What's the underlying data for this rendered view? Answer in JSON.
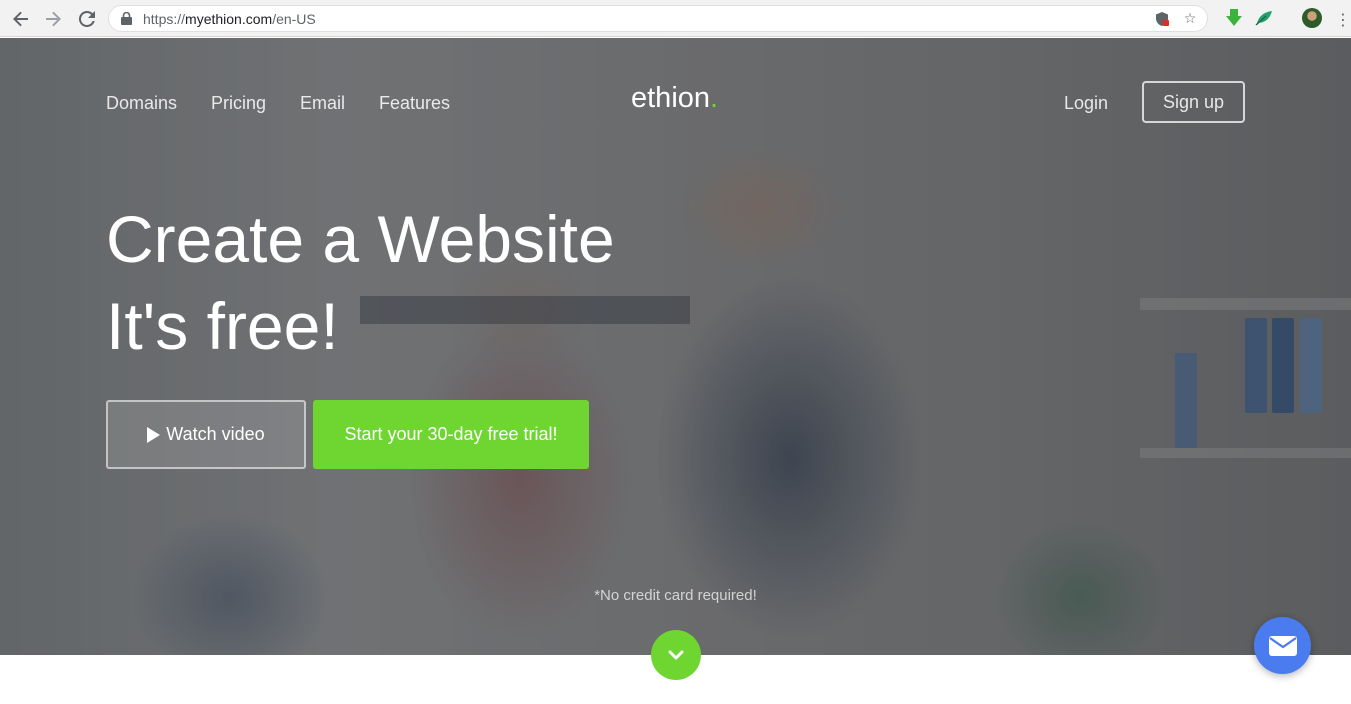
{
  "browser": {
    "back_icon": "back-arrow-icon",
    "forward_icon": "forward-arrow-icon",
    "reload_icon": "reload-icon",
    "url_prefix": "https://",
    "url_host": "myethion.com",
    "url_path": "/en-US",
    "bookmark_icon": "star-icon",
    "menu_icon": "kebab-menu-icon"
  },
  "nav": {
    "items": [
      "Domains",
      "Pricing",
      "Email",
      "Features"
    ],
    "logo_text": "ethion",
    "logo_dot": ".",
    "login_label": "Login",
    "signup_label": "Sign up"
  },
  "hero": {
    "headline_line1": "Create a Website",
    "headline_line2": "It's free!",
    "watch_label": "Watch video",
    "trial_label": "Start your 30-day free trial!",
    "note": "*No credit card required!"
  },
  "colors": {
    "accent_green": "#6fd631",
    "chat_blue": "#4a7cf0"
  }
}
